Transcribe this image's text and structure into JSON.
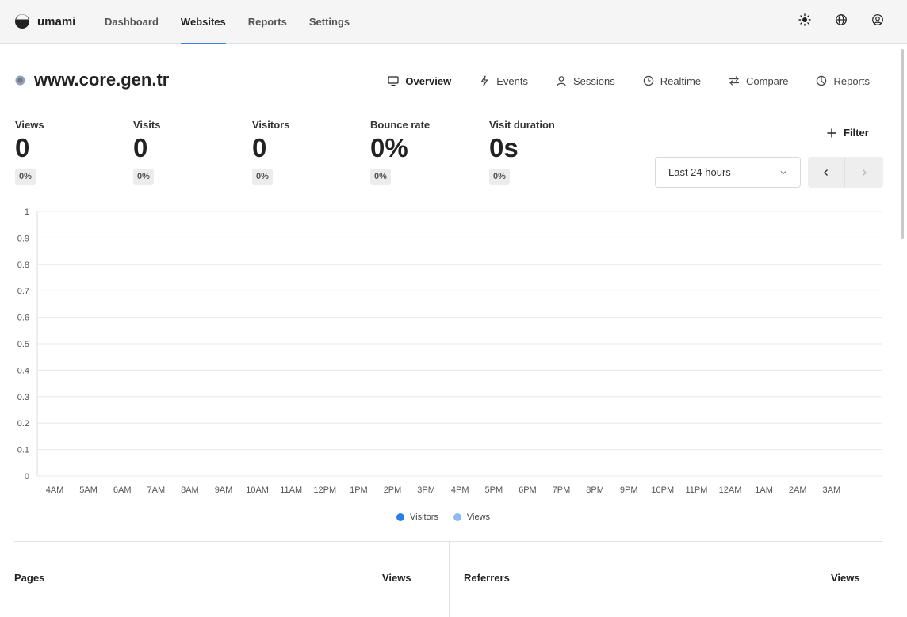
{
  "app": {
    "name": "umami"
  },
  "nav": {
    "items": [
      {
        "label": "Dashboard",
        "active": false
      },
      {
        "label": "Websites",
        "active": true
      },
      {
        "label": "Reports",
        "active": false
      },
      {
        "label": "Settings",
        "active": false
      }
    ]
  },
  "header_icons": [
    "sun-icon",
    "globe-icon",
    "user-circle-icon"
  ],
  "site": {
    "title": "www.core.gen.tr"
  },
  "tabs": [
    {
      "label": "Overview",
      "icon": "monitor-icon",
      "active": true
    },
    {
      "label": "Events",
      "icon": "lightning-icon",
      "active": false
    },
    {
      "label": "Sessions",
      "icon": "user-icon",
      "active": false
    },
    {
      "label": "Realtime",
      "icon": "clock-icon",
      "active": false
    },
    {
      "label": "Compare",
      "icon": "arrows-swap-icon",
      "active": false
    },
    {
      "label": "Reports",
      "icon": "pie-icon",
      "active": false
    }
  ],
  "metrics": [
    {
      "label": "Views",
      "value": "0",
      "change": "0%"
    },
    {
      "label": "Visits",
      "value": "0",
      "change": "0%"
    },
    {
      "label": "Visitors",
      "value": "0",
      "change": "0%"
    },
    {
      "label": "Bounce rate",
      "value": "0%",
      "change": "0%"
    },
    {
      "label": "Visit duration",
      "value": "0s",
      "change": "0%"
    }
  ],
  "controls": {
    "filter_label": "Filter",
    "date_range": "Last 24 hours"
  },
  "colors": {
    "accent": "#3e7fe0",
    "visitors": "#2680eb",
    "views": "#90b9f0",
    "grid": "#e8e8e8"
  },
  "chart_data": {
    "type": "bar",
    "categories": [
      "4AM",
      "5AM",
      "6AM",
      "7AM",
      "8AM",
      "9AM",
      "10AM",
      "11AM",
      "12PM",
      "1PM",
      "2PM",
      "3PM",
      "4PM",
      "5PM",
      "6PM",
      "7PM",
      "8PM",
      "9PM",
      "10PM",
      "11PM",
      "12AM",
      "1AM",
      "2AM",
      "3AM"
    ],
    "y_ticks": [
      "0",
      "0.1",
      "0.2",
      "0.3",
      "0.4",
      "0.5",
      "0.6",
      "0.7",
      "0.8",
      "0.9",
      "1"
    ],
    "series": [
      {
        "name": "Visitors",
        "values": [
          0,
          0,
          0,
          0,
          0,
          0,
          0,
          0,
          0,
          0,
          0,
          0,
          0,
          0,
          0,
          0,
          0,
          0,
          0,
          0,
          0,
          0,
          0,
          0
        ]
      },
      {
        "name": "Views",
        "values": [
          0,
          0,
          0,
          0,
          0,
          0,
          0,
          0,
          0,
          0,
          0,
          0,
          0,
          0,
          0,
          0,
          0,
          0,
          0,
          0,
          0,
          0,
          0,
          0
        ]
      }
    ],
    "ylim": [
      0,
      1
    ],
    "grid": true,
    "legend": "bottom-center"
  },
  "panels": {
    "left": {
      "title": "Pages",
      "metric": "Views"
    },
    "right": {
      "title": "Referrers",
      "metric": "Views"
    }
  }
}
